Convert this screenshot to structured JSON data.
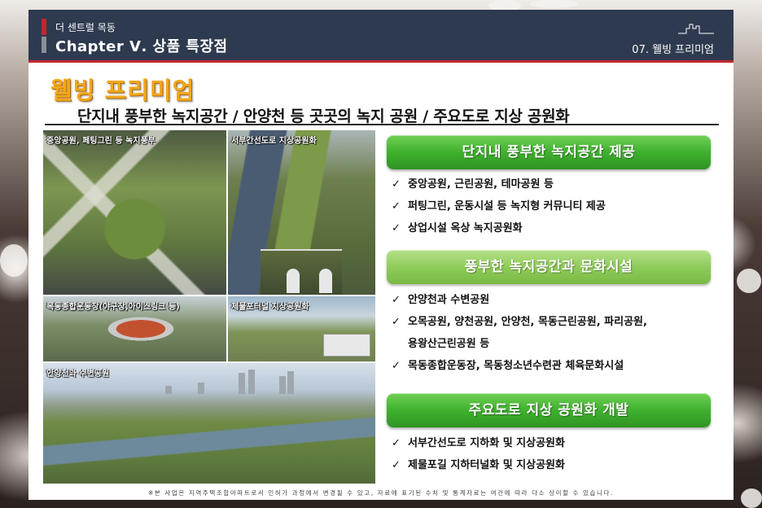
{
  "header": {
    "subtitle": "더 센트럴 목동",
    "title": "Chapter Ⅴ. 상품 특장점",
    "section": "07. 웰빙 프리미엄"
  },
  "main": {
    "heading": "웰빙 프리미엄",
    "subheading": "단지내 풍부한 녹지공간 / 안양천 등 곳곳의 녹지 공원 / 주요도로 지상 공원화"
  },
  "photos": [
    {
      "caption": "중앙공원, 페팅그린 등 녹지풍부"
    },
    {
      "caption": "서부간선도로 지상공원화"
    },
    {
      "caption": "목동종합운동장(야구장,아이스링크 등)"
    },
    {
      "caption": "제물포터널 지상공원화"
    },
    {
      "caption": "안양천과 수변공원"
    }
  ],
  "features": [
    {
      "title": "단지내 풍부한 녹지공간 제공",
      "items": [
        "중앙공원, 근린공원, 테마공원 등",
        "퍼팅그린, 운동시설 등 녹지형 커뮤니티 제공",
        "상업시설 옥상 녹지공원화"
      ]
    },
    {
      "title": "풍부한 녹지공간과 문화시설",
      "items": [
        "안양천과 수변공원",
        "오목공원, 양천공원, 안양천, 목동근린공원, 파리공원,",
        "용왕산근린공원 등",
        "목동종합운동장, 목동청소년수련관 체육문화시설"
      ]
    },
    {
      "title": "주요도로 지상 공원화 개발",
      "items": [
        "서부간선도로 지하화 및 지상공원화",
        "제물포길 지하터널화 및 지상공원화"
      ]
    }
  ],
  "check_symbol": "✓",
  "footnote": "※본 사업은 지역주택조합아파트로서 인허가 과정에서 변경될 수 있고, 자료에 표기된 수치 및 통계자료는 여건에 따라 다소 상이할 수 있습니다.",
  "colors": {
    "header_bg": "#2e3a4f",
    "accent_red": "#c0272d",
    "heading_orange": "#f2a81a",
    "button_green": "#3fb12e",
    "button_light_green": "#8fcc5a"
  },
  "icons": [
    "skyline-icon",
    "check-icon"
  ]
}
